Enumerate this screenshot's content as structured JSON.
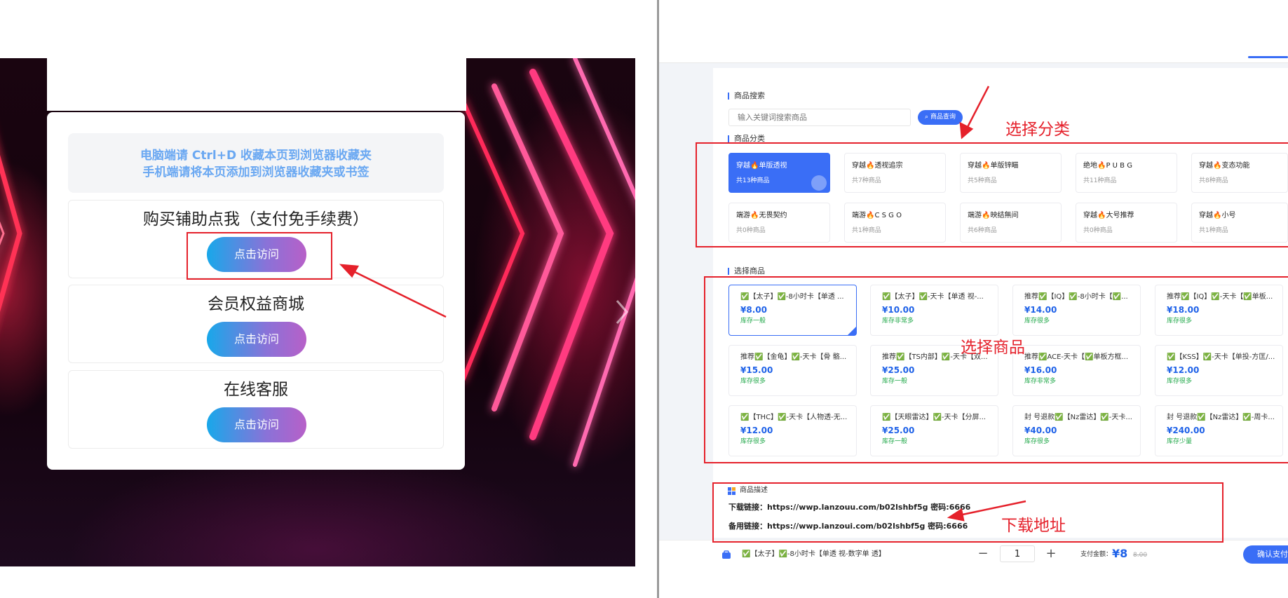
{
  "left": {
    "notice_line1": "电脑端请 Ctrl+D 收藏本页到浏览器收藏夹",
    "notice_line2": "手机端请将本页添加到浏览器收藏夹或书签",
    "entries": [
      {
        "title": "购买铺助点我（支付免手续费）",
        "button": "点击访问"
      },
      {
        "title": "会员权益商城",
        "button": "点击访问"
      },
      {
        "title": "在线客服",
        "button": "点击访问"
      }
    ]
  },
  "right": {
    "search": {
      "section_label": "商品搜索",
      "placeholder": "输入关键词搜索商品",
      "button": "商品查询"
    },
    "categories": {
      "section_label": "商品分类",
      "items": [
        {
          "name": "穿越🔥单版透视",
          "count": "共13种商品",
          "active": true
        },
        {
          "name": "穿越🔥透视追宗",
          "count": "共7种商品"
        },
        {
          "name": "穿越🔥单版锌瞄",
          "count": "共5种商品"
        },
        {
          "name": "绝地🔥P U B G",
          "count": "共11种商品"
        },
        {
          "name": "穿越🔥变态功能",
          "count": "共8种商品"
        },
        {
          "name": "端游🔥无畏契约",
          "count": "共0种商品"
        },
        {
          "name": "端游🔥C S G O",
          "count": "共1种商品"
        },
        {
          "name": "端游🔥映结無间",
          "count": "共6种商品"
        },
        {
          "name": "穿越🔥大号推荐",
          "count": "共0种商品"
        },
        {
          "name": "穿越🔥小号",
          "count": "共1种商品"
        }
      ]
    },
    "products": {
      "section_label": "选择商品",
      "items": [
        {
          "name": "✅【太子】✅-8小时卡【单透 ...",
          "price": "¥8.00",
          "stock": "库存一般",
          "selected": true
        },
        {
          "name": "✅【太子】✅-天卡【单透 视-...",
          "price": "¥10.00",
          "stock": "库存非常多"
        },
        {
          "name": "推荐✅【IQ】✅-8小时卡【✅...",
          "price": "¥14.00",
          "stock": "库存很多"
        },
        {
          "name": "推荐✅【IQ】✅-天卡【✅单板...",
          "price": "¥18.00",
          "stock": "库存很多"
        },
        {
          "name": "推荐✅【金龟】✅-天卡【骨 骼...",
          "price": "¥15.00",
          "stock": "库存很多"
        },
        {
          "name": "推荐✅【TS内部】✅-天卡【双...",
          "price": "¥25.00",
          "stock": "库存一般"
        },
        {
          "name": "推荐✅ACE-天卡【✅单板方框...",
          "price": "¥16.00",
          "stock": "库存非常多"
        },
        {
          "name": "✅【KSS】✅-天卡【单投-方匡/...",
          "price": "¥12.00",
          "stock": "库存很多"
        },
        {
          "name": "✅【THC】✅-天卡【人物透-无...",
          "price": "¥12.00",
          "stock": "库存很多"
        },
        {
          "name": "✅【天眼雷达】✅-天卡【分屏...",
          "price": "¥25.00",
          "stock": "库存一般"
        },
        {
          "name": "封 号退款✅【Nz雷达】✅-天卡...",
          "price": "¥40.00",
          "stock": "库存很多"
        },
        {
          "name": "封 号退款✅【Nz雷达】✅-周卡...",
          "price": "¥240.00",
          "stock": "库存少量"
        }
      ]
    },
    "description": {
      "title": "商品描述",
      "line1": "下载链接：https://wwp.lanzouu.com/b02lshbf5g  密码:6666",
      "line2": "备用链接：https://wwp.lanzoui.com/b02lshbf5g  密码:6666"
    },
    "footer": {
      "product": "✅【太子】✅-8小时卡【单透 视-数字单 透】",
      "minus": "−",
      "qty": "1",
      "plus": "+",
      "pay_label": "支付金额：",
      "amount": "¥8",
      "orig": "8.00",
      "confirm": "确认支付"
    }
  },
  "annotations": {
    "select_category": "选择分类",
    "select_product": "选择商品",
    "download_address": "下载地址"
  },
  "colors": {
    "accent": "#3a6ef6",
    "annotation_red": "#e5212b",
    "price_blue": "#1f62e8",
    "stock_green": "#21a84a"
  }
}
